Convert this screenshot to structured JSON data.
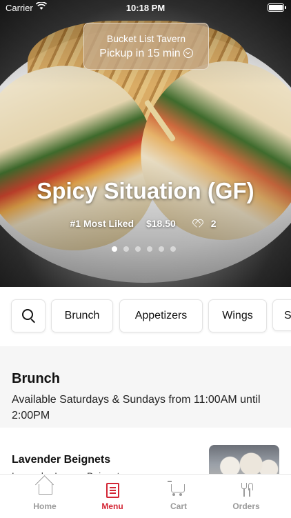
{
  "status_bar": {
    "carrier": "Carrier",
    "time": "10:18 PM"
  },
  "pickup": {
    "restaurant": "Bucket List Tavern",
    "pickup_time": "Pickup in 15 min"
  },
  "featured": {
    "title": "Spicy Situation (GF)",
    "rank": "#1 Most Liked",
    "price": "$18.50",
    "likes": "2",
    "carousel_page": 1,
    "carousel_total": 6
  },
  "categories": [
    "Brunch",
    "Appetizers",
    "Wings",
    "S"
  ],
  "section": {
    "title": "Brunch",
    "description": "Available Saturdays & Sundays from 11:00AM until 2:00PM"
  },
  "item": {
    "name": "Lavender Beignets",
    "subtitle": "Lavender Lemon Beignets"
  },
  "tabs": [
    {
      "label": "Home",
      "icon": "home-icon"
    },
    {
      "label": "Menu",
      "icon": "menu-icon"
    },
    {
      "label": "Cart",
      "icon": "cart-icon"
    },
    {
      "label": "Orders",
      "icon": "utensils-icon"
    }
  ],
  "colors": {
    "accent": "#d32635",
    "inactive": "#9a9a9a"
  }
}
